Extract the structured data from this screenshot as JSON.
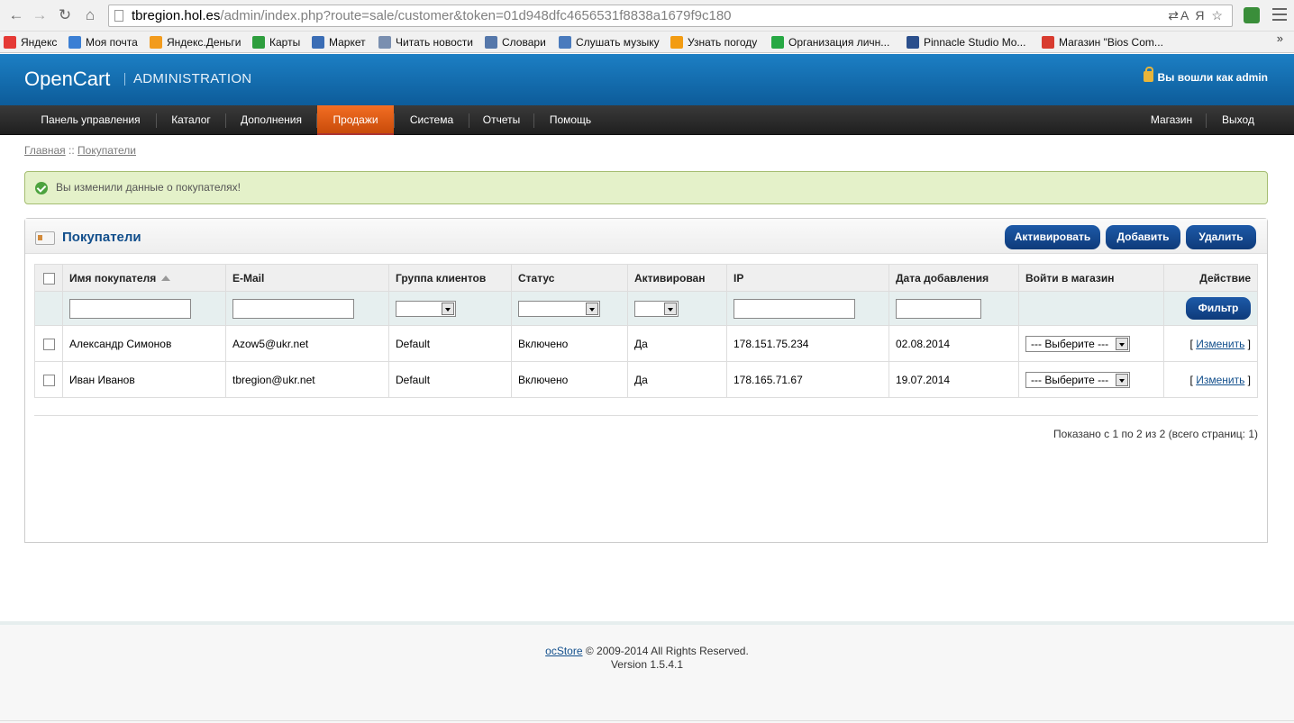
{
  "browser": {
    "url_host": "tbregion.hol.es",
    "url_path": "/admin/index.php?route=sale/customer&token=01d948dfc4656531f8838a1679f9c180",
    "url_right_icons": "⇄A Я ☆",
    "bookmarks": [
      {
        "label": "Яндекс",
        "color": "#e53935"
      },
      {
        "label": "Моя почта",
        "color": "#3b7fd4"
      },
      {
        "label": "Яндекс.Деньги",
        "color": "#f29b1d"
      },
      {
        "label": "Карты",
        "color": "#2e9e3e"
      },
      {
        "label": "Маркет",
        "color": "#3a6db5"
      },
      {
        "label": "Читать новости",
        "color": "#7a8fb0"
      },
      {
        "label": "Словари",
        "color": "#5577aa"
      },
      {
        "label": "Слушать музыку",
        "color": "#4a7bbd"
      },
      {
        "label": "Узнать погоду",
        "color": "#f39c12"
      },
      {
        "label": "Организация личн...",
        "color": "#27a844"
      },
      {
        "label": "Pinnacle Studio Mo...",
        "color": "#2b4f8c"
      },
      {
        "label": "Магазин \"Bios Com...",
        "color": "#d83b2f"
      }
    ],
    "more": "»"
  },
  "header": {
    "logo": "OpenCart",
    "subtitle": "ADMINISTRATION",
    "login_text": "Вы вошли как admin"
  },
  "menu": {
    "items": [
      "Панель управления",
      "Каталог",
      "Дополнения",
      "Продажи",
      "Система",
      "Отчеты",
      "Помощь"
    ],
    "active": "Продажи",
    "right": [
      "Магазин",
      "Выход"
    ]
  },
  "breadcrumb": {
    "home": "Главная",
    "sep": "::",
    "current": "Покупатели"
  },
  "alert": {
    "text": "Вы изменили данные о покупателях!"
  },
  "box": {
    "title": "Покупатели",
    "buttons": {
      "activate": "Активировать",
      "add": "Добавить",
      "delete": "Удалить"
    }
  },
  "table": {
    "columns": [
      "Имя покупателя",
      "E-Mail",
      "Группа клиентов",
      "Статус",
      "Активирован",
      "IP",
      "Дата добавления",
      "Войти в магазин",
      "Действие"
    ],
    "filter_button": "Фильтр",
    "rows": [
      {
        "name": "Александр Симонов",
        "email": "Azow5@ukr.net",
        "group": "Default",
        "status": "Включено",
        "approved": "Да",
        "ip": "178.151.75.234",
        "date": "02.08.2014",
        "login_select": "--- Выберите ---",
        "action": "Изменить"
      },
      {
        "name": "Иван Иванов",
        "email": "tbregion@ukr.net",
        "group": "Default",
        "status": "Включено",
        "approved": "Да",
        "ip": "178.165.71.67",
        "date": "19.07.2014",
        "login_select": "--- Выберите ---",
        "action": "Изменить"
      }
    ],
    "pagination": "Показано с 1 по 2 из 2 (всего страниц: 1)"
  },
  "footer": {
    "brand": "ocStore",
    "copyright": "© 2009-2014 All Rights Reserved.",
    "version": "Version 1.5.4.1"
  }
}
